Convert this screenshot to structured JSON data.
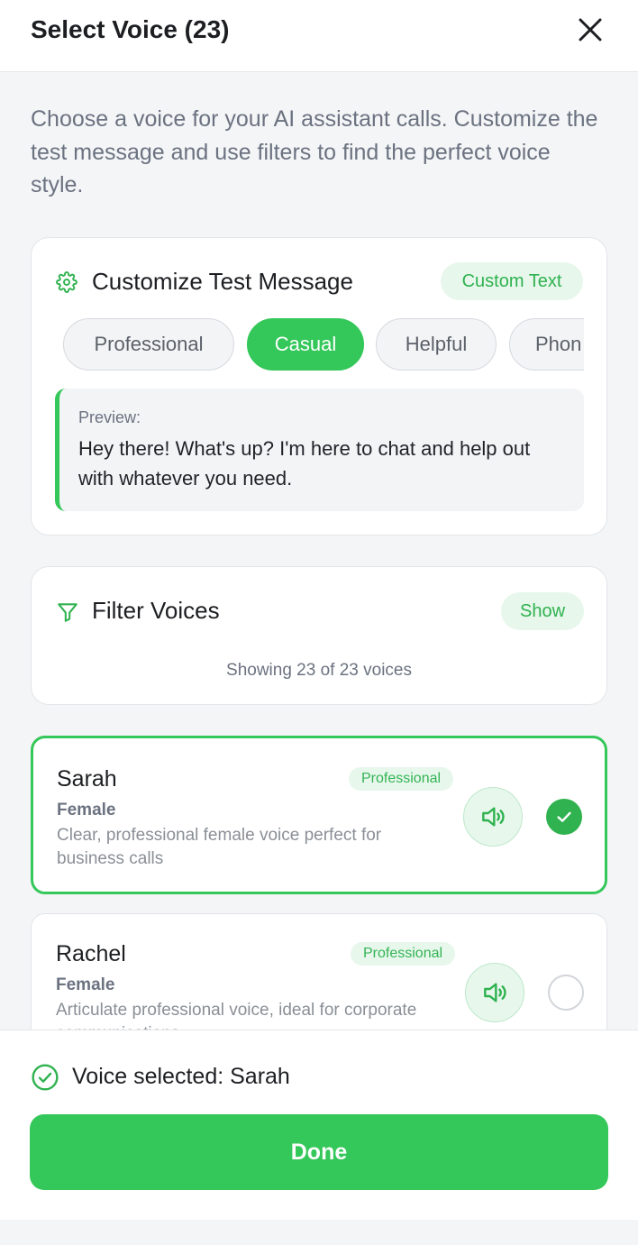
{
  "header": {
    "title": "Select Voice (23)"
  },
  "intro": "Choose a voice for your AI assistant calls. Customize the test message and use filters to find the perfect voice style.",
  "customize": {
    "title": "Customize Test Message",
    "custom_text_label": "Custom Text",
    "chips": [
      {
        "label": "Professional",
        "active": false
      },
      {
        "label": "Casual",
        "active": true
      },
      {
        "label": "Helpful",
        "active": false
      },
      {
        "label": "Phon",
        "active": false
      }
    ],
    "preview_label": "Preview:",
    "preview_text": "Hey there! What's up? I'm here to chat and help out with whatever you need."
  },
  "filter": {
    "title": "Filter Voices",
    "show_label": "Show",
    "count_text": "Showing 23 of 23 voices"
  },
  "voices": [
    {
      "name": "Sarah",
      "gender": "Female",
      "tag": "Professional",
      "description": "Clear, professional female voice perfect for business calls",
      "selected": true
    },
    {
      "name": "Rachel",
      "gender": "Female",
      "tag": "Professional",
      "description": "Articulate professional voice, ideal for corporate communications",
      "selected": false
    }
  ],
  "footer": {
    "selected_text": "Voice selected: Sarah",
    "done_label": "Done"
  },
  "colors": {
    "accent": "#34c759",
    "accent_soft": "#e7f7ec",
    "muted_text": "#6b7280"
  },
  "icons": [
    "close-icon",
    "gear-icon",
    "filter-icon",
    "speaker-icon",
    "check-icon",
    "check-circle-icon"
  ]
}
